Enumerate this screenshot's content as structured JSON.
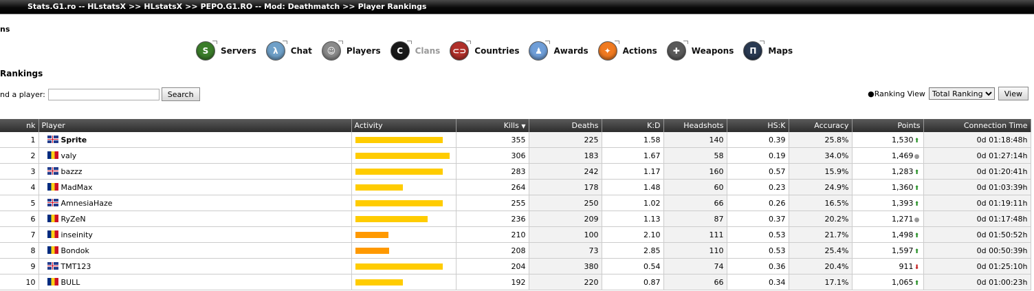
{
  "header": {
    "crumbs": [
      "Stats.G1.ro -- HLstatsX",
      "HLstatsX",
      "PEPO.G1.RO -- Mod: Deathmatch",
      "Player Rankings"
    ],
    "separator": ">>"
  },
  "subtitle": "ns",
  "nav": [
    {
      "label": "Servers",
      "icon": "servers-icon",
      "color": "#3b7d2a",
      "glyph": "S"
    },
    {
      "label": "Chat",
      "icon": "chat-icon",
      "color": "#6fa0c8",
      "glyph": "λ"
    },
    {
      "label": "Players",
      "icon": "players-icon",
      "color": "#8a8a8a",
      "glyph": "☺"
    },
    {
      "label": "Clans",
      "icon": "clans-icon",
      "color": "#1a1a1a",
      "glyph": "C",
      "disabled": true
    },
    {
      "label": "Countries",
      "icon": "countries-icon",
      "color": "#b0302a",
      "glyph": "⊂⊃"
    },
    {
      "label": "Awards",
      "icon": "awards-icon",
      "color": "#6f9ed8",
      "glyph": "♟"
    },
    {
      "label": "Actions",
      "icon": "actions-icon",
      "color": "#f07a20",
      "glyph": "✦"
    },
    {
      "label": "Weapons",
      "icon": "weapons-icon",
      "color": "#5a5a5a",
      "glyph": "✚"
    },
    {
      "label": "Maps",
      "icon": "maps-icon",
      "color": "#2a3a52",
      "glyph": "Π"
    }
  ],
  "section_title": "Rankings",
  "search": {
    "label": "nd a player:",
    "value": "",
    "button": "Search"
  },
  "ranking_view": {
    "label": "Ranking View",
    "selected": "Total Ranking",
    "button": "View"
  },
  "columns": [
    "nk",
    "Player",
    "Activity",
    "Kills",
    "Deaths",
    "K:D",
    "Headshots",
    "HS:K",
    "Accuracy",
    "Points",
    "Connection Time"
  ],
  "sort_indicator": "▼",
  "rows": [
    {
      "rank": "1",
      "flag": "gb",
      "player": "Sprite",
      "bold": true,
      "activity": 0.88,
      "activity_color": "#ffcc00",
      "kills": "355",
      "deaths": "225",
      "kd": "1.58",
      "hs": "140",
      "hsk": "0.39",
      "acc": "25.8%",
      "points": "1,530",
      "trend": "up",
      "time": "0d 01:18:48h"
    },
    {
      "rank": "2",
      "flag": "ro",
      "player": "valy",
      "activity": 0.95,
      "activity_color": "#ffcc00",
      "kills": "306",
      "deaths": "183",
      "kd": "1.67",
      "hs": "58",
      "hsk": "0.19",
      "acc": "34.0%",
      "points": "1,469",
      "trend": "same",
      "time": "0d 01:27:14h"
    },
    {
      "rank": "3",
      "flag": "gb",
      "player": "bazzz",
      "activity": 0.88,
      "activity_color": "#ffcc00",
      "kills": "283",
      "deaths": "242",
      "kd": "1.17",
      "hs": "160",
      "hsk": "0.57",
      "acc": "15.9%",
      "points": "1,283",
      "trend": "up",
      "time": "0d 01:20:41h"
    },
    {
      "rank": "4",
      "flag": "ro",
      "player": "MadMax",
      "activity": 0.48,
      "activity_color": "#ffcc00",
      "kills": "264",
      "deaths": "178",
      "kd": "1.48",
      "hs": "60",
      "hsk": "0.23",
      "acc": "24.9%",
      "points": "1,360",
      "trend": "up",
      "time": "0d 01:03:39h"
    },
    {
      "rank": "5",
      "flag": "gb",
      "player": "AmnesiaHaze",
      "activity": 0.88,
      "activity_color": "#ffcc00",
      "kills": "255",
      "deaths": "250",
      "kd": "1.02",
      "hs": "66",
      "hsk": "0.26",
      "acc": "16.5%",
      "points": "1,393",
      "trend": "up",
      "time": "0d 01:19:11h"
    },
    {
      "rank": "6",
      "flag": "ro",
      "player": "RyZeN",
      "activity": 0.73,
      "activity_color": "#ffcc00",
      "kills": "236",
      "deaths": "209",
      "kd": "1.13",
      "hs": "87",
      "hsk": "0.37",
      "acc": "20.2%",
      "points": "1,271",
      "trend": "same",
      "time": "0d 01:17:48h"
    },
    {
      "rank": "7",
      "flag": "ro",
      "player": "inseinity",
      "activity": 0.33,
      "activity_color": "#ff9900",
      "kills": "210",
      "deaths": "100",
      "kd": "2.10",
      "hs": "111",
      "hsk": "0.53",
      "acc": "21.7%",
      "points": "1,498",
      "trend": "up",
      "time": "0d 01:50:52h"
    },
    {
      "rank": "8",
      "flag": "ro",
      "player": "Bondok",
      "activity": 0.34,
      "activity_color": "#ff9900",
      "kills": "208",
      "deaths": "73",
      "kd": "2.85",
      "hs": "110",
      "hsk": "0.53",
      "acc": "25.4%",
      "points": "1,597",
      "trend": "up",
      "time": "0d 00:50:39h"
    },
    {
      "rank": "9",
      "flag": "gb",
      "player": "TMT123",
      "activity": 0.88,
      "activity_color": "#ffcc00",
      "kills": "204",
      "deaths": "380",
      "kd": "0.54",
      "hs": "74",
      "hsk": "0.36",
      "acc": "20.4%",
      "points": "911",
      "trend": "down",
      "time": "0d 01:25:10h"
    },
    {
      "rank": "10",
      "flag": "ro",
      "player": "BULL",
      "activity": 0.48,
      "activity_color": "#ffcc00",
      "kills": "192",
      "deaths": "220",
      "kd": "0.87",
      "hs": "66",
      "hsk": "0.34",
      "acc": "17.1%",
      "points": "1,065",
      "trend": "up",
      "time": "0d 01:00:23h"
    }
  ]
}
